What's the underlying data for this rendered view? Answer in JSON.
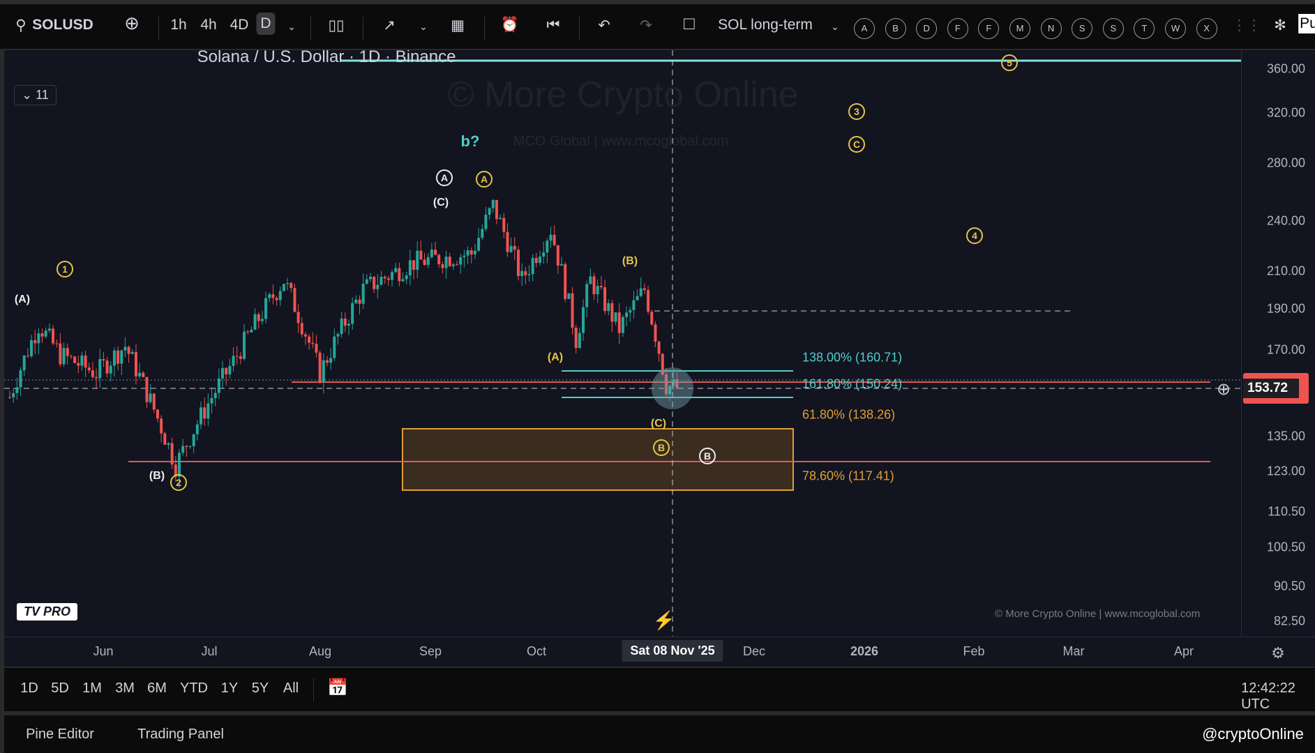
{
  "toolbar": {
    "symbol": "SOLUSD",
    "intervals": [
      "1h",
      "4h",
      "4D",
      "D"
    ],
    "layout_name": "SOL long-term",
    "letters": [
      "A",
      "B",
      "D",
      "F",
      "F",
      "M",
      "N",
      "S",
      "S",
      "T",
      "W",
      "X"
    ],
    "partial": "Pu"
  },
  "legend": {
    "title": "Solana / U.S. Dollar · 1D · Binance",
    "indicators_count": "11"
  },
  "watermark": {
    "main": "© More Crypto Online",
    "sub": "MCO Global  |  www.mcoglobal.com",
    "footer": "© More Crypto Online  |  www.mcoglobal.com"
  },
  "waves": {
    "w1": "1",
    "w2": "2",
    "w3": "3",
    "w4": "4",
    "w5": "5",
    "A_left": "(A)",
    "B_left": "(B)",
    "A_circ_white": "A",
    "A_circ_yellow": "A",
    "C_white": "(C)",
    "b_q": "b?",
    "C_circ": "C",
    "B_y": "(B)",
    "A_y": "(A)",
    "C_y": "(C)",
    "B_circ_yellow": "B",
    "B_circ_white": "B"
  },
  "fib": {
    "f138": "138.00% (160.71)",
    "f1618": "161.80% (150.24)",
    "f618": "61.80% (138.26)",
    "f786": "78.60% (117.41)"
  },
  "price_axis": {
    "labels": [
      "360.00",
      "320.00",
      "280.00",
      "240.00",
      "210.00",
      "190.00",
      "170.00",
      "135.00",
      "123.00",
      "110.50",
      "100.50",
      "90.50",
      "82.50"
    ],
    "current": "153.72"
  },
  "time_axis": {
    "labels": [
      "Jun",
      "Jul",
      "Aug",
      "Sep",
      "Oct",
      "Dec",
      "2026",
      "Feb",
      "Mar",
      "Apr"
    ],
    "crosshair": "Sat 08 Nov '25"
  },
  "range_bar": {
    "ranges": [
      "1D",
      "5D",
      "1M",
      "3M",
      "6M",
      "YTD",
      "1Y",
      "5Y",
      "All"
    ],
    "clock": "12:42:22 UTC"
  },
  "bottom": {
    "pine": "Pine Editor",
    "trading": "Trading Panel",
    "handle": "@cryptoOnline"
  },
  "logo": {
    "text": "TV PRO"
  },
  "colors": {
    "up": "#26a69a",
    "down": "#ef5350",
    "teal": "#4dd0c8",
    "fib_orange": "#e0a030",
    "wave_yellow": "#e8c547"
  },
  "price_waypoints": [
    [
      0,
      150
    ],
    [
      8,
      182
    ],
    [
      14,
      168
    ],
    [
      24,
      160
    ],
    [
      32,
      172
    ],
    [
      46,
      125
    ],
    [
      62,
      165
    ],
    [
      76,
      205
    ],
    [
      86,
      160
    ],
    [
      98,
      200
    ],
    [
      112,
      215
    ],
    [
      128,
      220
    ],
    [
      134,
      250
    ],
    [
      142,
      205
    ],
    [
      150,
      235
    ],
    [
      157,
      175
    ],
    [
      161,
      205
    ],
    [
      169,
      180
    ],
    [
      176,
      200
    ],
    [
      182,
      155
    ],
    [
      185,
      153.72
    ]
  ]
}
